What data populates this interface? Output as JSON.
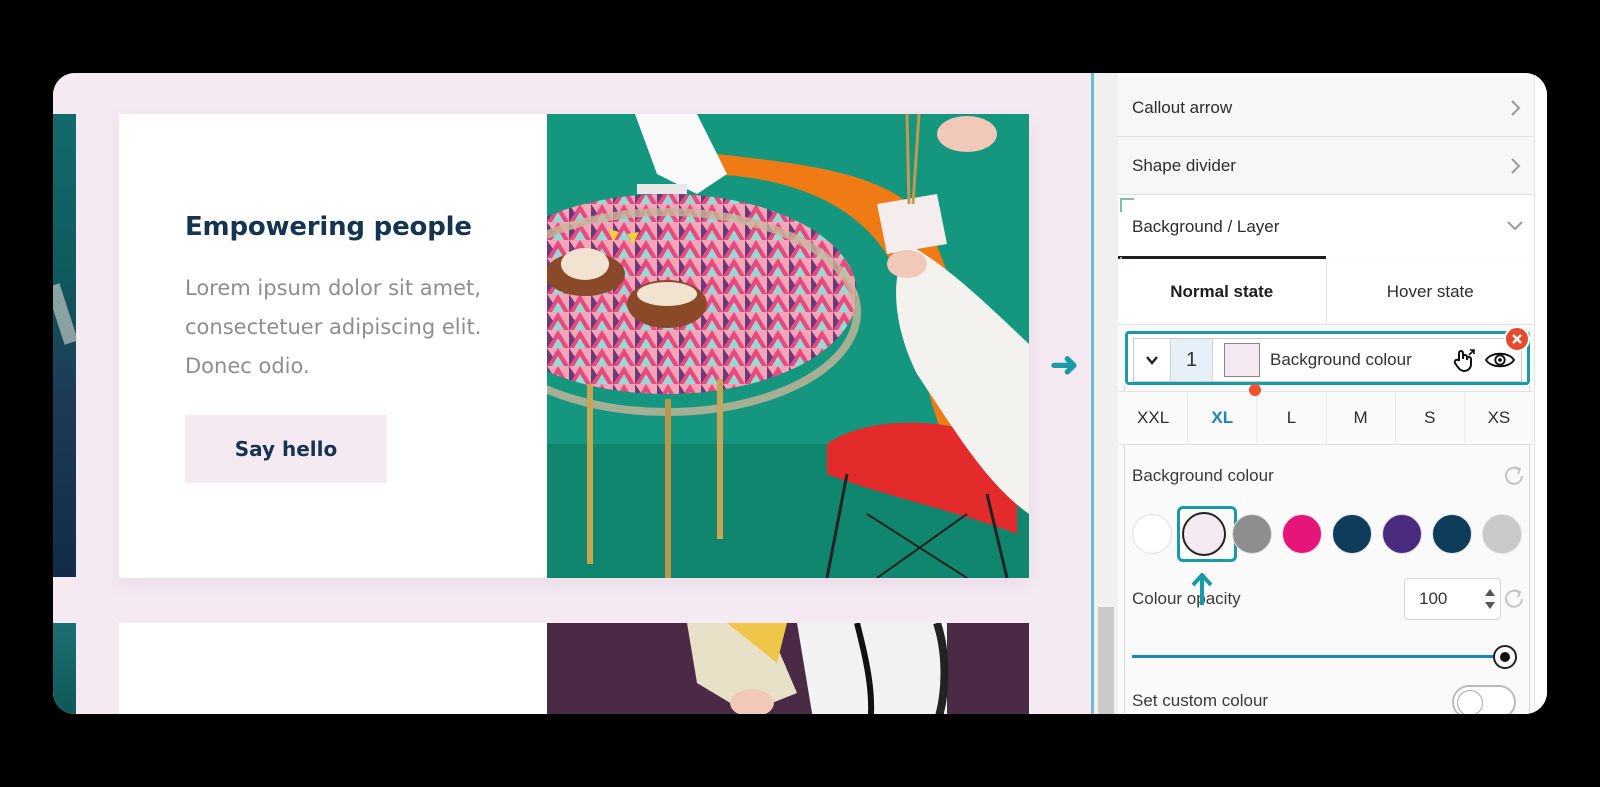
{
  "preview": {
    "card_title": "Empowering people",
    "card_body": "Lorem ipsum dolor sit amet, consectetuer adipiscing elit. Donec odio.",
    "card_button": "Say hello",
    "bg_color": "#f5e9f2"
  },
  "panel": {
    "accordions": [
      {
        "label": "Callout arrow"
      },
      {
        "label": "Shape divider"
      },
      {
        "label": "Background / Layer"
      }
    ],
    "state_tabs": [
      {
        "label": "Normal state",
        "active": true
      },
      {
        "label": "Hover state",
        "active": false
      }
    ],
    "layer": {
      "index": "1",
      "label": "Background colour",
      "swatch_color": "#f5e9f2"
    },
    "breakpoints": [
      {
        "label": "XXL"
      },
      {
        "label": "XL",
        "active": true
      },
      {
        "label": "L"
      },
      {
        "label": "M"
      },
      {
        "label": "S"
      },
      {
        "label": "XS"
      }
    ],
    "bg_colour_label": "Background colour",
    "swatches": [
      "#ffffff",
      "#f5e9f2",
      "#8e8e8e",
      "#e6157a",
      "#0e3d5c",
      "#4b2b80",
      "#0e3d5c",
      "#c9c9c9"
    ],
    "selected_swatch_index": 1,
    "opacity_label": "Colour opacity",
    "opacity_value": "100",
    "custom_colour_label": "Set custom colour"
  },
  "colors": {
    "accent": "#1a9aa6",
    "active_blue": "#1b86b6",
    "close_red": "#e64a2e"
  }
}
